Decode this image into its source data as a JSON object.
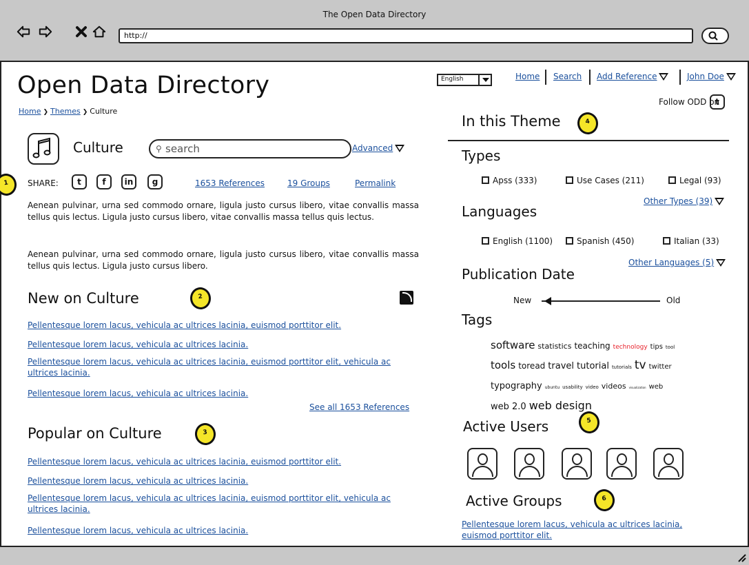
{
  "window": {
    "title": "The Open Data Directory",
    "url": "http://"
  },
  "header": {
    "site_title": "Open Data Directory",
    "breadcrumb": [
      "Home",
      "Themes",
      "Culture"
    ],
    "language": "English",
    "nav": [
      "Home",
      "Search",
      "Add Reference",
      "John Doe"
    ],
    "follow_text": "Follow ODD on"
  },
  "theme": {
    "name": "Culture",
    "search_placeholder": "search",
    "advanced_label": "Advanced",
    "share_label": "SHARE:",
    "share_icons": [
      "twitter-icon",
      "facebook-icon",
      "linkedin-icon",
      "google-icon"
    ],
    "stats": {
      "references": "1653 References",
      "groups": "19 Groups",
      "permalink": "Permalink"
    },
    "description": [
      "Aenean pulvinar, urna sed commodo ornare, ligula justo cursus libero, vitae convallis massa tellus quis lectus. Ligula justo cursus libero, vitae convallis massa tellus quis lectus.",
      "Aenean pulvinar, urna sed commodo ornare, ligula justo cursus libero, vitae convallis massa tellus quis lectus. Ligula justo cursus libero."
    ]
  },
  "new_section": {
    "title": "New on Culture",
    "links": [
      "Pellentesque lorem lacus, vehicula ac ultrices lacinia, euismod porttitor elit.",
      "Pellentesque lorem lacus, vehicula ac ultrices lacinia.",
      "Pellentesque lorem lacus, vehicula ac ultrices lacinia, euismod porttitor elit, vehicula ac ultrices lacinia.",
      "Pellentesque lorem lacus, vehicula ac ultrices lacinia."
    ],
    "see_all": "See all 1653 References"
  },
  "popular_section": {
    "title": "Popular on Culture",
    "links": [
      "Pellentesque lorem lacus, vehicula ac ultrices lacinia, euismod porttitor elit.",
      "Pellentesque lorem lacus, vehicula ac ultrices lacinia.",
      "Pellentesque lorem lacus, vehicula ac ultrices lacinia, euismod porttitor elit, vehicula ac ultrices lacinia.",
      "Pellentesque lorem lacus, vehicula ac ultrices lacinia."
    ]
  },
  "sidebar": {
    "title": "In this Theme",
    "types": {
      "title": "Types",
      "options": [
        "Apss (333)",
        "Use Cases (211)",
        "Legal (93)"
      ],
      "other": "Other Types (39)"
    },
    "languages": {
      "title": "Languages",
      "options": [
        "English (1100)",
        "Spanish (450)",
        "Italian (33)"
      ],
      "other": "Other Languages (5)"
    },
    "publication_date": {
      "title": "Publication Date",
      "new_label": "New",
      "old_label": "Old",
      "position": 0.05
    },
    "tags": {
      "title": "Tags",
      "items": [
        "software",
        "statistics",
        "teaching",
        "technology",
        "tips",
        "tool",
        "tools",
        "toread",
        "travel",
        "tutorial",
        "tutorials",
        "tv",
        "twitter",
        "typography",
        "ubuntu",
        "usability",
        "video",
        "videos",
        "visualization",
        "web",
        "web 2.0",
        "web design"
      ],
      "highlight_color": "#e8202a"
    },
    "active_users": {
      "title": "Active Users",
      "count": 5
    },
    "active_groups": {
      "title": "Active Groups",
      "link": "Pellentesque lorem lacus, vehicula ac ultrices lacinia, euismod porttitor elit."
    }
  },
  "annotations": [
    "1",
    "2",
    "3",
    "4",
    "5",
    "6"
  ],
  "colors": {
    "link": "#1a4f9c",
    "badge": "#f5e628",
    "chrome": "#c8c8c8"
  }
}
